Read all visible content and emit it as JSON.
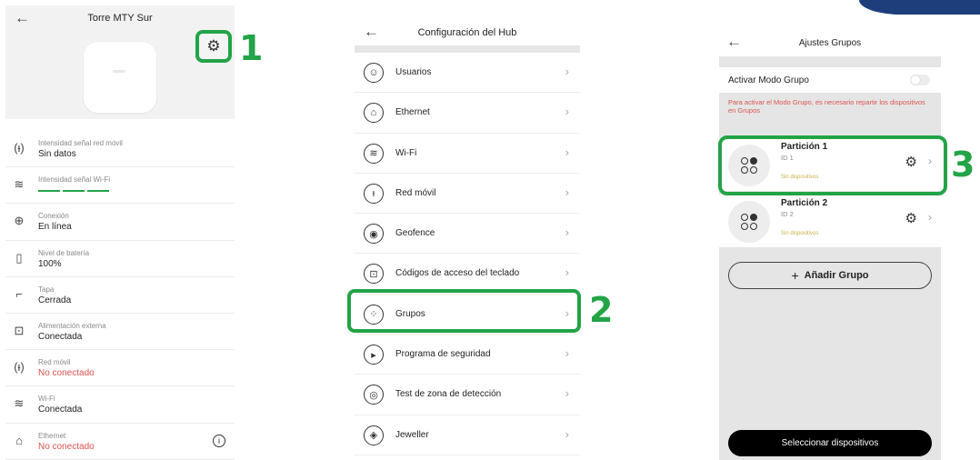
{
  "colors": {
    "accent_green": "#22a447",
    "alert_red": "#d9534f",
    "corner_blue": "#1d3e7b"
  },
  "panel1": {
    "title": "Torre MTY Sur",
    "rows": [
      {
        "icon": "cell-signal-icon",
        "label": "Intensidad señal red móvil",
        "value": "Sin datos"
      },
      {
        "icon": "wifi-icon",
        "label": "Intensidad señal Wi-Fi",
        "value": ""
      },
      {
        "icon": "globe-icon",
        "label": "Conexión",
        "value": "En línea"
      },
      {
        "icon": "battery-icon",
        "label": "Nivel de batería",
        "value": "100%"
      },
      {
        "icon": "lid-icon",
        "label": "Tapa",
        "value": "Cerrada"
      },
      {
        "icon": "power-icon",
        "label": "Alimentación externa",
        "value": "Conectada"
      },
      {
        "icon": "cell-signal-icon",
        "label": "Red móvil",
        "value": "No conectado"
      },
      {
        "icon": "wifi-icon",
        "label": "Wi-Fi",
        "value": "Conectada"
      },
      {
        "icon": "ethernet-icon",
        "label": "Ethernet",
        "value": "No conectado"
      }
    ]
  },
  "panel2": {
    "title": "Configuración del Hub",
    "items": [
      {
        "icon": "user-icon",
        "label": "Usuarios"
      },
      {
        "icon": "ethernet-icon",
        "label": "Ethernet"
      },
      {
        "icon": "wifi-icon",
        "label": "Wi-Fi"
      },
      {
        "icon": "cell-signal-icon",
        "label": "Red móvil"
      },
      {
        "icon": "geofence-icon",
        "label": "Geofence"
      },
      {
        "icon": "lock-icon",
        "label": "Códigos de acceso del teclado"
      },
      {
        "icon": "groups-icon",
        "label": "Grupos"
      },
      {
        "icon": "play-icon",
        "label": "Programa de seguridad"
      },
      {
        "icon": "detection-icon",
        "label": "Test de zona de detección"
      },
      {
        "icon": "jeweller-icon",
        "label": "Jeweller"
      }
    ]
  },
  "panel3": {
    "title": "Ajustes Grupos",
    "mode_label": "Activar Modo Grupo",
    "note": "Para activar el Modo Grupo, es necesario repartir los dispositivos en Grupos",
    "partitions": [
      {
        "name": "Partición 1",
        "id": "ID 1",
        "status": "Sin dispositivos"
      },
      {
        "name": "Partición 2",
        "id": "ID 2",
        "status": "Sin dispositivos"
      }
    ],
    "add_label": "Añadir Grupo",
    "select_label": "Seleccionar dispositivos"
  },
  "annotations": {
    "one": "1",
    "two": "2",
    "three": "3"
  }
}
